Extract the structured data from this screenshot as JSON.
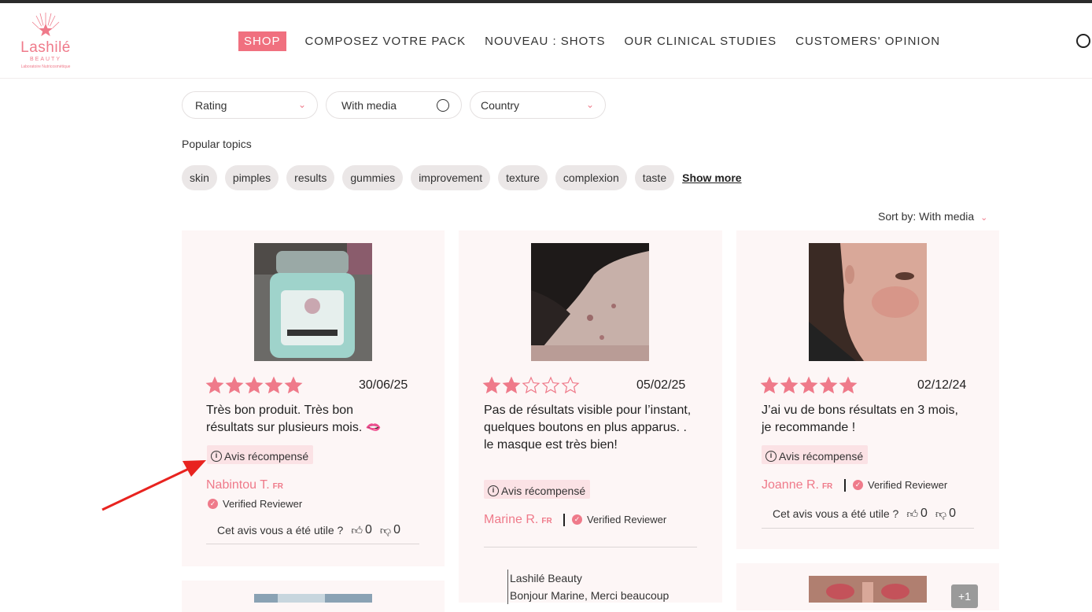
{
  "header": {
    "logo": {
      "name": "Lashilé",
      "sub": "BEAUTY",
      "tagline": "Laboratoire Nutricosmétique"
    },
    "nav": [
      "SHOP",
      "COMPOSEZ VOTRE PACK",
      "NOUVEAU : SHOTS",
      "OUR CLINICAL STUDIES",
      "CUSTOMERS' OPINION"
    ],
    "active_nav": "SHOP"
  },
  "filters": {
    "rating": "Rating",
    "with_media": "With media",
    "country": "Country"
  },
  "popular_topics": {
    "label": "Popular topics",
    "chips": [
      "skin",
      "pimples",
      "results",
      "gummies",
      "improvement",
      "texture",
      "complexion",
      "taste"
    ],
    "show_more": "Show more"
  },
  "sort": {
    "label": "Sort by:",
    "value": "With media"
  },
  "colors": {
    "accent": "#ef7a8a",
    "card_bg": "#fdf6f6",
    "badge_bg": "#fbe2e5",
    "chip_bg": "#ebe7e7"
  },
  "reviews": [
    {
      "stars": 5,
      "date": "30/06/25",
      "text": "Très bon produit. Très bon résultats sur plusieurs mois. 🫦",
      "badge": "Avis récompensé",
      "author": "Nabintou T.",
      "country": "FR",
      "verified": "Verified Reviewer",
      "helpful": "Cet avis vous a été utile ?",
      "up": "0",
      "down": "0"
    },
    {
      "stars": 2,
      "date": "05/02/25",
      "text": "Pas de résultats visible pour l’instant, quelques boutons en plus apparus. . le masque est très bien!",
      "badge": "Avis récompensé",
      "author": "Marine R.",
      "country": "FR",
      "verified": "Verified Reviewer",
      "reply_from": "Lashilé Beauty",
      "reply_text": "Bonjour Marine, Merci beaucoup"
    },
    {
      "stars": 5,
      "date": "02/12/24",
      "text": "J’ai vu de bons résultats en 3 mois, je recommande !",
      "badge": "Avis récompensé",
      "author": "Joanne R.",
      "country": "FR",
      "verified": "Verified Reviewer",
      "helpful": "Cet avis vous a été utile ?",
      "up": "0",
      "down": "0"
    }
  ],
  "more_media": "+1"
}
